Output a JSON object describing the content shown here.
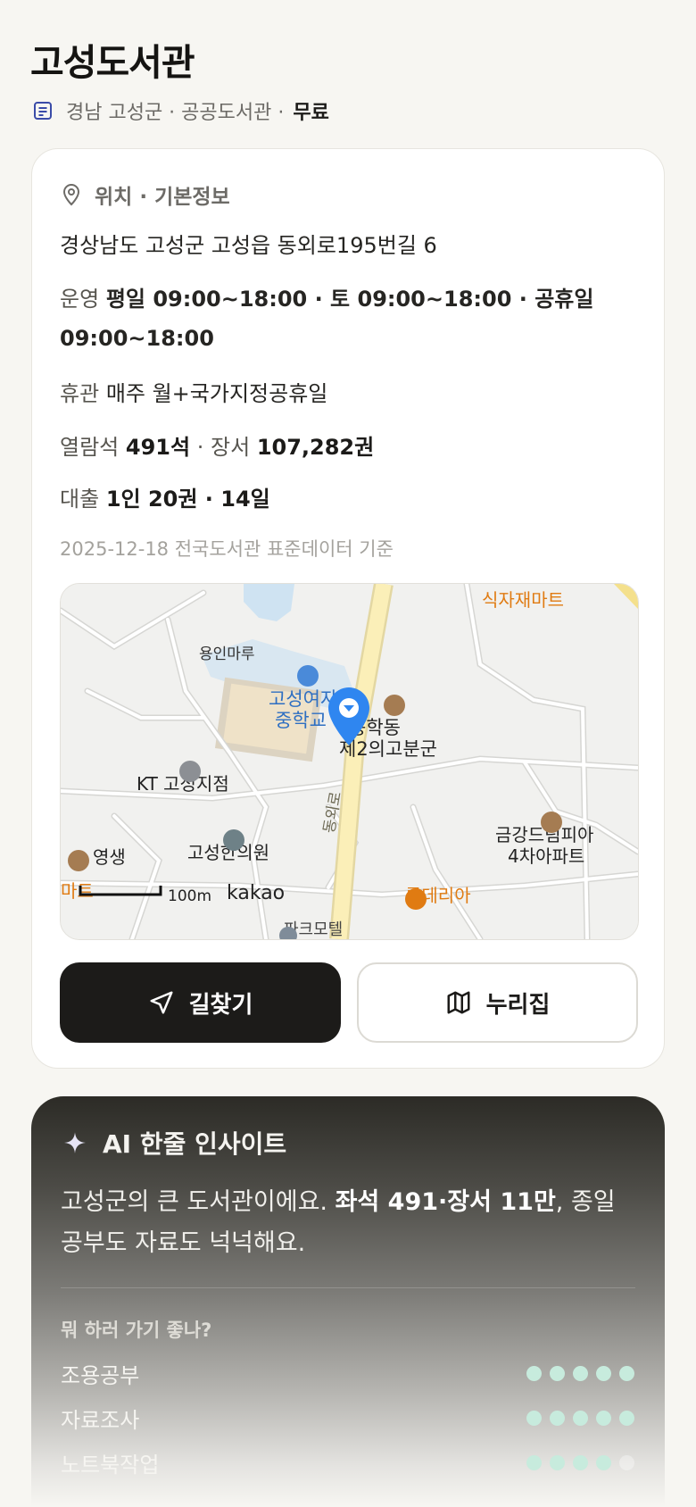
{
  "header": {
    "title": "고성도서관",
    "sub_prefix": "경남 고성군 · 공공도서관 ·",
    "sub_free": "무료"
  },
  "info": {
    "section_title": "위치 · 기본정보",
    "address": "경상남도 고성군 고성읍 동외로195번길 6",
    "hours_label": "운영",
    "hours_value": "평일 09:00~18:00 · 토 09:00~18:00 · 공휴일 09:00~18:00",
    "closed_label": "휴관",
    "closed_value": "매주 월+국가지정공휴일",
    "seats_label": "열람석",
    "seats_value": "491석",
    "sep": "·",
    "books_label": "장서",
    "books_value": "107,282권",
    "loan_label": "대출",
    "loan_value": "1인 20권 · 14일",
    "basis": "2025-12-18 전국도서관 표준데이터 기준"
  },
  "map": {
    "labels": {
      "yongin": "용인마루",
      "school1": "고성여자",
      "school2": "중학교",
      "songhak": "송학동",
      "gobungun": "제2의고분군",
      "kt": "KT 고성지점",
      "hanuiwon": "고성한의원",
      "yeongsaeng": "영생",
      "mart_frag": "마트",
      "sikjae": "식자재마트",
      "geumgang1": "금강드림피아",
      "geumgang2": "4차아파트",
      "lotteria": "롯데리아",
      "road": "동외로",
      "motel": "파크모텔",
      "scale": "100m",
      "brand": "kakao"
    }
  },
  "actions": {
    "directions": "길찾기",
    "website": "누리집"
  },
  "ai": {
    "title": "AI 한줄 인사이트",
    "text_a": "고성군의 큰 도서관이에요.",
    "text_b": "좌석 491·장서 11만",
    "text_c": ", 종일 공부도 자료도 넉넉해요.",
    "question": "뭐 하러 가기 좋나?",
    "ratings": [
      {
        "label": "조용공부",
        "score": 5
      },
      {
        "label": "자료조사",
        "score": 5
      },
      {
        "label": "노트북작업",
        "score": 4
      }
    ]
  },
  "colors": {
    "accent_dark": "#1c1b19",
    "map_pin": "#2f86f0",
    "poi_orange": "#e07b12",
    "rating_dot": "#c7ebdd"
  }
}
